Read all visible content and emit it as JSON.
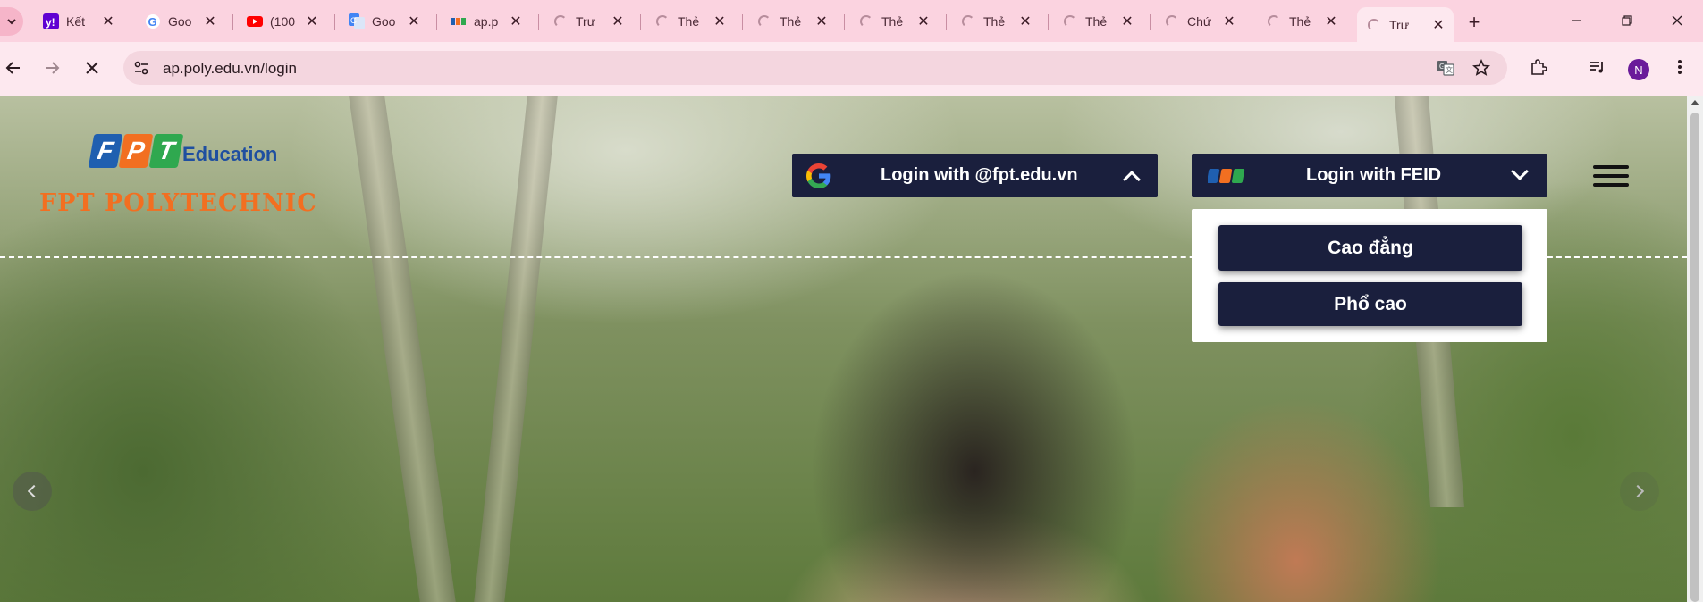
{
  "browser": {
    "tabs": [
      {
        "title": "Kết",
        "favicon": "yahoo-icon"
      },
      {
        "title": "Goo",
        "favicon": "google-icon"
      },
      {
        "title": "(100",
        "favicon": "youtube-icon"
      },
      {
        "title": "Goo",
        "favicon": "google-translate-icon"
      },
      {
        "title": "ap.p",
        "favicon": "fpt-icon"
      },
      {
        "title": "Trư",
        "favicon": "loading-spinner-icon"
      },
      {
        "title": "Thẻ",
        "favicon": "loading-spinner-icon"
      },
      {
        "title": "Thẻ",
        "favicon": "loading-spinner-icon"
      },
      {
        "title": "Thẻ",
        "favicon": "loading-spinner-icon"
      },
      {
        "title": "Thẻ",
        "favicon": "loading-spinner-icon"
      },
      {
        "title": "Thẻ",
        "favicon": "loading-spinner-icon"
      },
      {
        "title": "Chứ",
        "favicon": "loading-spinner-icon"
      },
      {
        "title": "Thẻ",
        "favicon": "loading-spinner-icon"
      },
      {
        "title": "Trư",
        "favicon": "loading-spinner-icon",
        "active": true
      }
    ],
    "address_url": "ap.poly.edu.vn/login",
    "profile_initial": "N",
    "colors": {
      "tabstrip": "#fbd3e0",
      "toolbar": "#fde8ef",
      "profile": "#6a1b9a"
    }
  },
  "page": {
    "logo": {
      "fpt_letters": [
        "F",
        "P",
        "T"
      ],
      "education": "Education",
      "polytechnic": "FPT POLYTECHNIC"
    },
    "login_google": {
      "label": "Login with @fpt.edu.vn",
      "icon": "google-icon",
      "expanded": false
    },
    "login_feid": {
      "label": "Login with FEID",
      "icon": "fpt-icon",
      "expanded": true
    },
    "feid_options": [
      "Cao đẳng",
      "Phổ cao"
    ],
    "colors": {
      "button_bg": "#1a1f3d",
      "brand_orange": "#f26f21",
      "brand_blue": "#1f4fa0",
      "brand_green": "#2fa84f"
    }
  }
}
